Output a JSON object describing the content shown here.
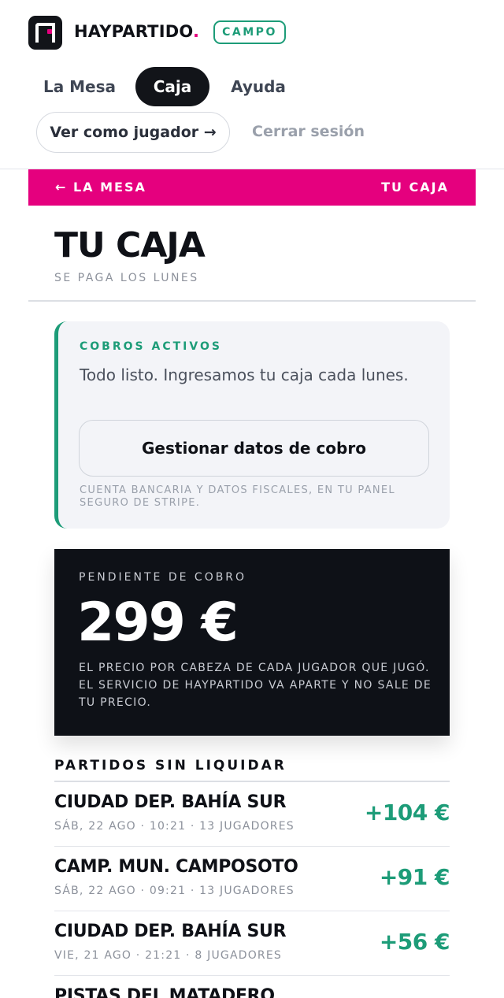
{
  "brand": {
    "name": "HAYPARTIDO",
    "dot": ".",
    "badge": "CAMPO"
  },
  "nav": {
    "tabs": [
      "La Mesa",
      "Caja",
      "Ayuda"
    ],
    "active_tab": "Caja"
  },
  "account": {
    "view_as_player": "Ver como jugador →",
    "logout": "Cerrar sesión"
  },
  "breadcrumb": {
    "back": "← LA MESA",
    "current": "TU CAJA"
  },
  "page": {
    "title": "TU CAJA",
    "subtitle": "SE PAGA LOS LUNES"
  },
  "payouts": {
    "label": "COBROS ACTIVOS",
    "message": "Todo listo. Ingresamos tu caja cada lunes.",
    "button": "Gestionar datos de cobro",
    "note": "CUENTA BANCARIA Y DATOS FISCALES, EN TU PANEL SEGURO DE STRIPE."
  },
  "pending": {
    "label": "PENDIENTE DE COBRO",
    "amount": "299 €",
    "note": "EL PRECIO POR CABEZA DE CADA JUGADOR QUE JUGÓ. EL SERVICIO DE HAYPARTIDO VA APARTE Y NO SALE DE TU PRECIO."
  },
  "matches": {
    "title": "PARTIDOS SIN LIQUIDAR",
    "items": [
      {
        "venue": "CIUDAD DEP. BAHÍA SUR",
        "meta": "SÁB, 22 AGO · 10:21 · 13 JUGADORES",
        "amount": "+104 €"
      },
      {
        "venue": "CAMP. MUN. CAMPOSOTO",
        "meta": "SÁB, 22 AGO · 09:21 · 13 JUGADORES",
        "amount": "+91 €"
      },
      {
        "venue": "CIUDAD DEP. BAHÍA SUR",
        "meta": "VIE, 21 AGO · 21:21 · 8 JUGADORES",
        "amount": "+56 €"
      },
      {
        "venue": "PISTAS DEL MATADERO",
        "meta": "",
        "amount": ""
      }
    ]
  },
  "colors": {
    "brand_pink": "#e5007e",
    "accent_green": "#1d9c78",
    "dark": "#0e1117"
  }
}
